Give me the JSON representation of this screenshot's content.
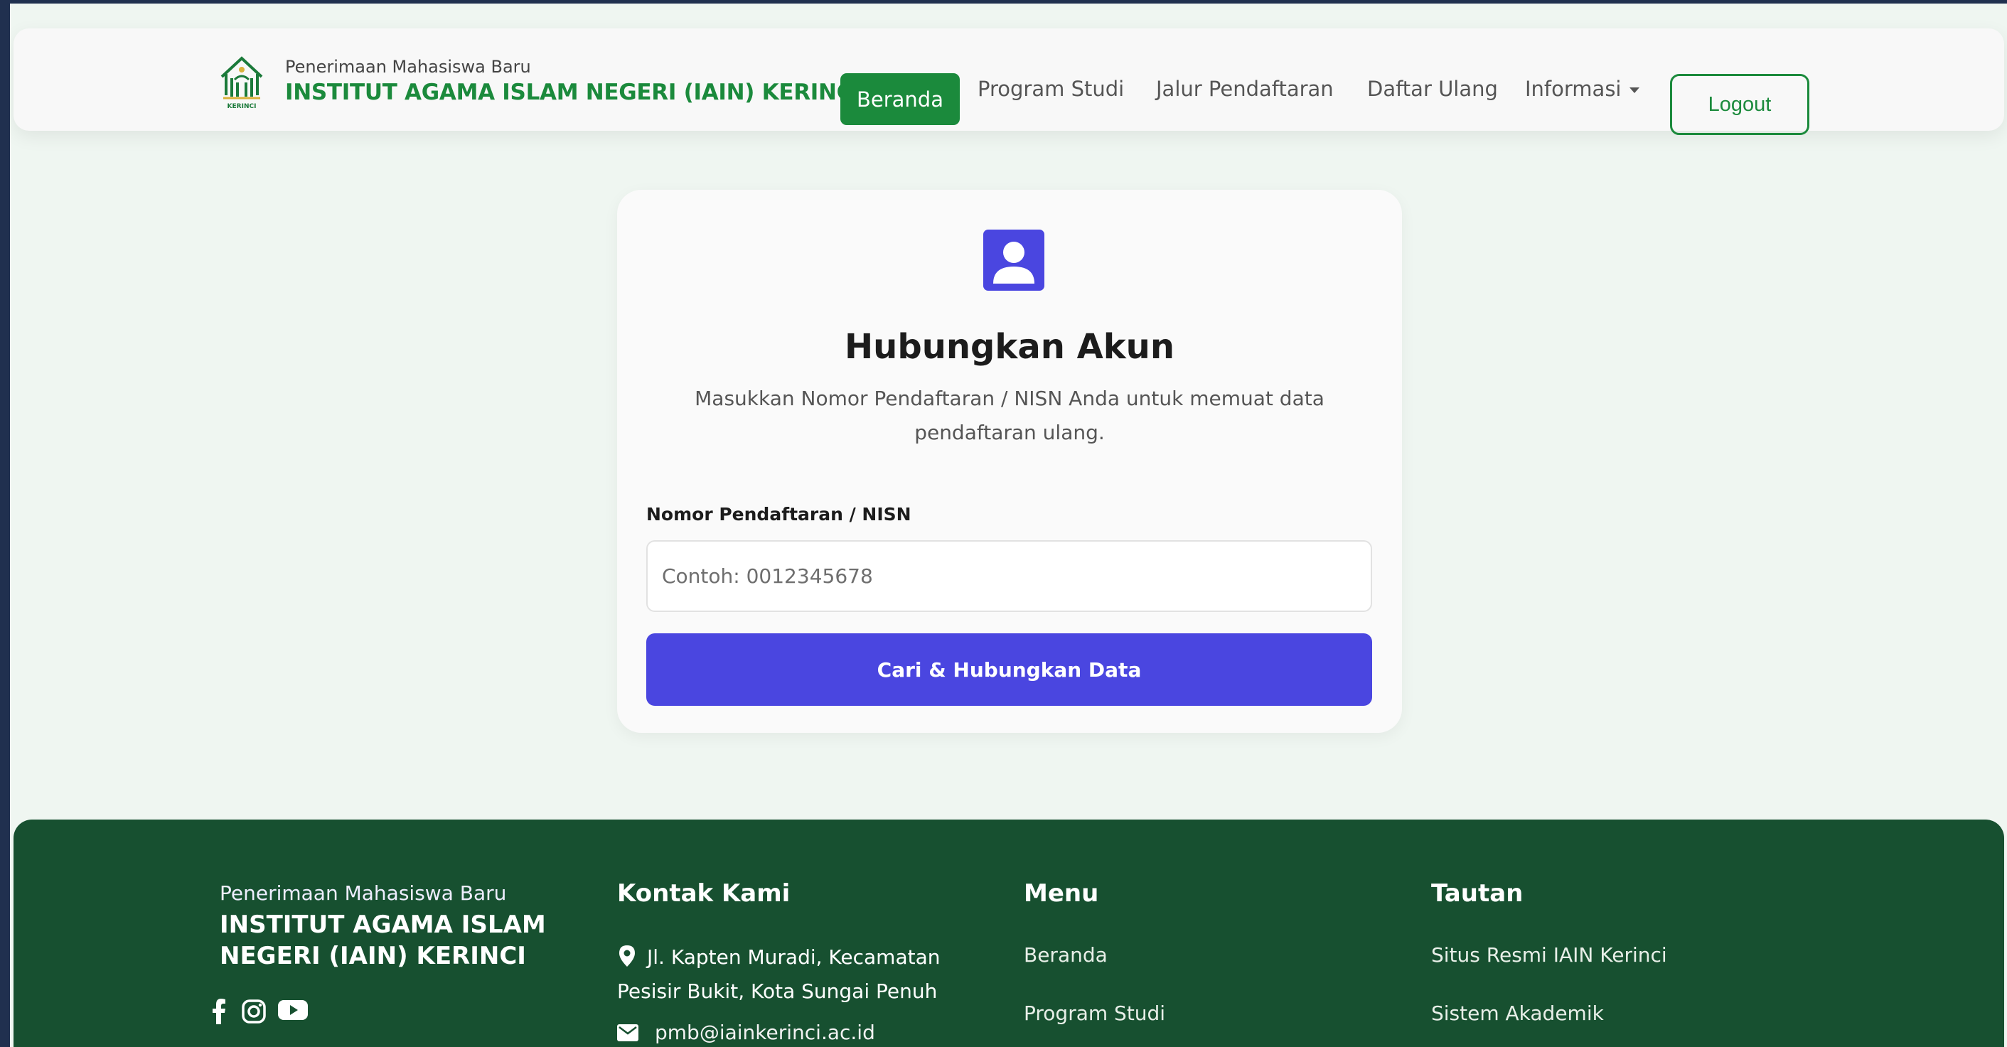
{
  "navbar": {
    "brand_sub": "Penerimaan Mahasiswa Baru",
    "brand_title": "INSTITUT AGAMA ISLAM NEGERI (IAIN) KERINCI",
    "logo_text": "KERINCI",
    "items": [
      "Beranda",
      "Program Studi",
      "Jalur Pendaftaran",
      "Daftar Ulang",
      "Informasi"
    ],
    "active_item": "Beranda",
    "logout_label": "Logout"
  },
  "card": {
    "icon": "user-portrait-icon",
    "title": "Hubungkan Akun",
    "description": "Masukkan Nomor Pendaftaran / NISN Anda untuk memuat data pendaftaran ulang.",
    "field_label": "Nomor Pendaftaran / NISN",
    "field_placeholder": "Contoh: 0012345678",
    "field_value": "",
    "submit_label": "Cari & Hubungkan Data"
  },
  "footer": {
    "brand_sub": "Penerimaan Mahasiswa Baru",
    "brand_title": "INSTITUT AGAMA ISLAM NEGERI (IAIN) KERINCI",
    "social": [
      "facebook-icon",
      "instagram-icon",
      "youtube-icon"
    ],
    "contact": {
      "heading": "Kontak Kami",
      "address": "Jl. Kapten Muradi, Kecamatan Pesisir Bukit, Kota Sungai Penuh",
      "email": "pmb@iainkerinci.ac.id"
    },
    "menu": {
      "heading": "Menu",
      "items": [
        "Beranda",
        "Program Studi"
      ]
    },
    "links": {
      "heading": "Tautan",
      "items": [
        "Situs Resmi IAIN Kerinci",
        "Sistem Akademik"
      ]
    }
  },
  "colors": {
    "primary_green": "#1b8a3c",
    "footer_green": "#175030",
    "accent_indigo": "#4a46e0",
    "page_bg": "#eff6f1"
  }
}
